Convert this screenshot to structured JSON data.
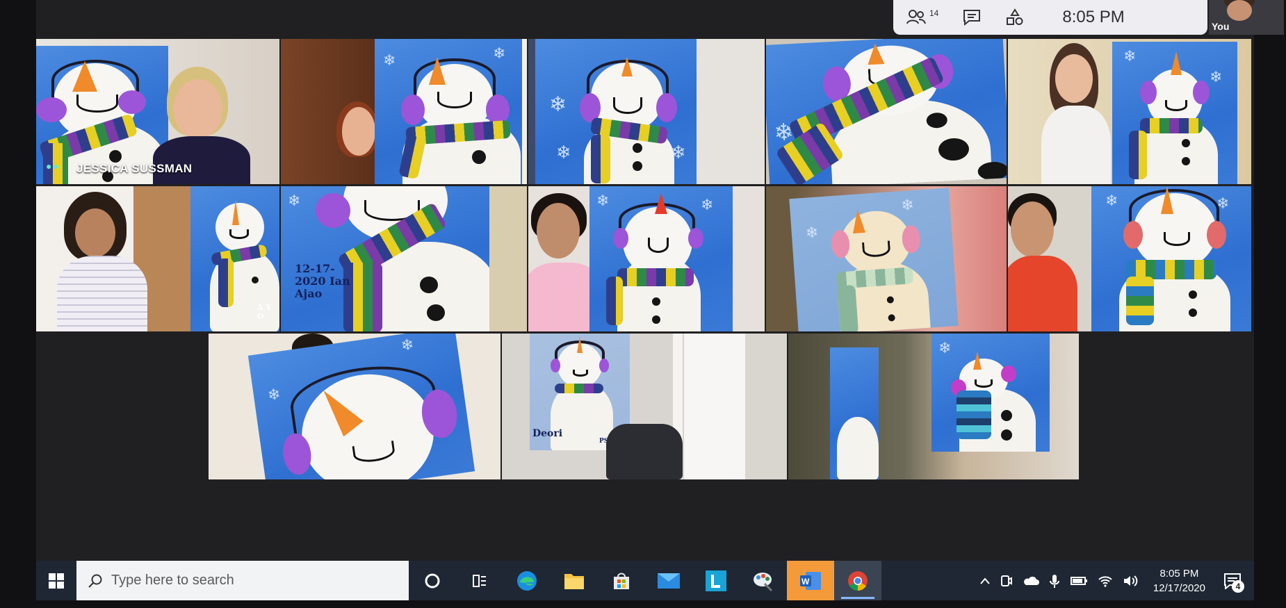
{
  "call_bar": {
    "participants_count": "14",
    "time": "8:05 PM",
    "self_label": "You"
  },
  "tiles": [
    {
      "name_label": "JESSICA SUSSMAN"
    },
    {
      "name_label": ""
    },
    {
      "name_label": ""
    }
  ],
  "paintings": {
    "signature_1": "12-17-2020 Ian Ajao",
    "signature_2": "A Y O",
    "signature_3": "Deori",
    "signature_4": "PS 186"
  },
  "taskbar": {
    "search_placeholder": "Type here to search",
    "clock_time": "8:05 PM",
    "clock_date": "12/17/2020",
    "notification_count": "4",
    "pinned_apps": [
      "cortana-icon",
      "task-view-icon",
      "edge-icon",
      "file-explorer-icon",
      "store-icon",
      "mail-icon",
      "l-app-icon",
      "paint-icon",
      "word-icon",
      "chrome-icon"
    ]
  },
  "colors": {
    "taskbar_bg": "#1e2733",
    "accent_active_speaker": "#5bd2d6",
    "painting_blue": "#2f6fd1"
  }
}
